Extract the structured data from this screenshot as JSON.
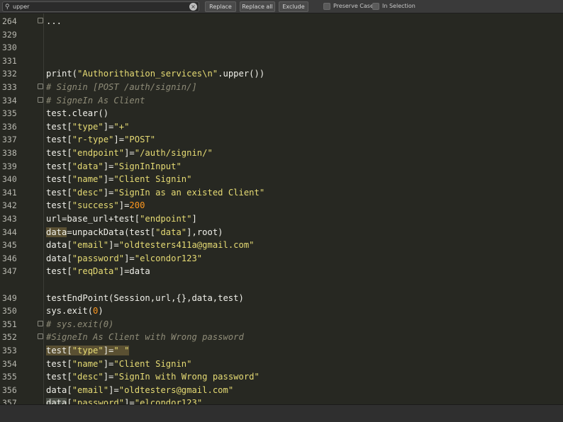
{
  "find_bar": {
    "search_value": "upper",
    "replace_label": "Replace",
    "replace_all_label": "Replace all",
    "exclude_label": "Exclude",
    "preserve_case_label": "Preserve Case",
    "in_selection_label": "In Selection"
  },
  "editor": {
    "lines": [
      {
        "n": "264",
        "code": "..."
      },
      {
        "n": "329",
        "code": ""
      },
      {
        "n": "330",
        "code": ""
      },
      {
        "n": "331",
        "code": ""
      },
      {
        "n": "332",
        "code": "print(\"Authorithation_services\\n\".upper())"
      },
      {
        "n": "333",
        "code": "# Signin [POST /auth/signin/]"
      },
      {
        "n": "334",
        "code": "# SigneIn As Client"
      },
      {
        "n": "335",
        "code": "test.clear()"
      },
      {
        "n": "336",
        "code": "test[\"type\"]=\"+\""
      },
      {
        "n": "337",
        "code": "test[\"r-type\"]=\"POST\""
      },
      {
        "n": "338",
        "code": "test[\"endpoint\"]=\"/auth/signin/\""
      },
      {
        "n": "339",
        "code": "test[\"data\"]=\"SignInInput\""
      },
      {
        "n": "340",
        "code": "test[\"name\"]=\"Client Signin\""
      },
      {
        "n": "341",
        "code": "test[\"desc\"]=\"SignIn as an existed Client\""
      },
      {
        "n": "342",
        "code": "test[\"success\"]=200"
      },
      {
        "n": "343",
        "code": "url=base_url+test[\"endpoint\"]"
      },
      {
        "n": "344",
        "code": "data=unpackData(test[\"data\"],root)"
      },
      {
        "n": "345",
        "code": "data[\"email\"]=\"oldtesters411a@gmail.com\""
      },
      {
        "n": "346",
        "code": "data[\"password\"]=\"elcondor123\""
      },
      {
        "n": "347",
        "code": "test[\"reqData\"]=data"
      },
      {
        "n": "",
        "code": ""
      },
      {
        "n": "349",
        "code": "testEndPoint(Session,url,{},data,test)"
      },
      {
        "n": "350",
        "code": "sys.exit(0)"
      },
      {
        "n": "351",
        "code": "# sys.exit(0)"
      },
      {
        "n": "352",
        "code": "#SigneIn As Client with Wrong password"
      },
      {
        "n": "353",
        "code": "test[\"type\"]=\" \""
      },
      {
        "n": "354",
        "code": "test[\"name\"]=\"Client Signin\""
      },
      {
        "n": "355",
        "code": "test[\"desc\"]=\"SignIn with Wrong password\""
      },
      {
        "n": "356",
        "code": "data[\"email\"]=\"oldtesters@gmail.com\""
      },
      {
        "n": "357",
        "code": "data[\"password\"]=\"elcondor123\""
      }
    ]
  },
  "status_bar": {
    "text": ""
  },
  "colors": {
    "background": "#272822",
    "string": "#e6db74",
    "number": "#fd971f",
    "comment": "#8f8c78",
    "highlight": "#5a5032"
  }
}
